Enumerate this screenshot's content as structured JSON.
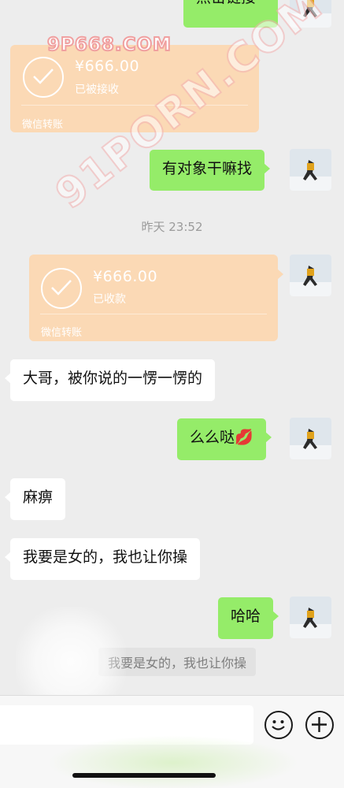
{
  "top_bubble": {
    "text": "点击链接"
  },
  "transfer_1": {
    "amount": "¥666.00",
    "status": "已被接收",
    "label": "微信转账"
  },
  "msg_1": {
    "text": "有对象干嘛找"
  },
  "timestamp": "昨天 23:52",
  "transfer_2": {
    "amount": "¥666.00",
    "status": "已收款",
    "label": "微信转账"
  },
  "msg_2": {
    "text": "大哥，被你说的一愣一愣的"
  },
  "msg_3": {
    "text": "么么哒💋"
  },
  "msg_4": {
    "text": "麻痹"
  },
  "msg_5": {
    "text": "我要是女的，我也让你操"
  },
  "msg_6": {
    "text": "哈哈"
  },
  "quote": {
    "text": "我要是女的，我也让你操"
  },
  "watermarks": {
    "top": "9P668.COM",
    "diagonal": "91PORN.COM"
  },
  "input_bar": {
    "placeholder": ""
  },
  "icons": {
    "emoji": "emoji-icon",
    "plus": "plus-icon"
  },
  "colors": {
    "green_bubble": "#95ec69",
    "transfer_card": "#fbd9b5",
    "background": "#ededed"
  }
}
